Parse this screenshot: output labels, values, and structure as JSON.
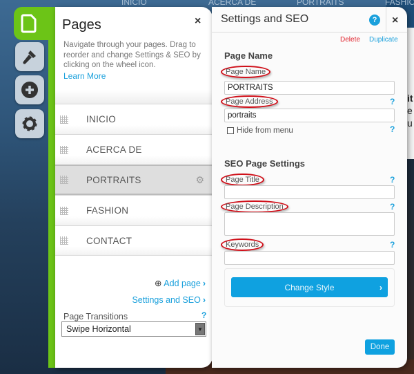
{
  "background": {
    "nav": [
      "INICIO",
      "ACERCA DE",
      "PORTRAITS",
      "FASHIO"
    ],
    "fragments": [
      "it",
      "e",
      "u"
    ]
  },
  "toolbar": {
    "items": [
      {
        "icon": "page-icon",
        "active": true
      },
      {
        "icon": "paintbrush-icon"
      },
      {
        "icon": "add-icon"
      },
      {
        "icon": "gear-icon"
      }
    ],
    "accent": "#6cc417"
  },
  "pages_panel": {
    "title": "Pages",
    "close": "×",
    "description": "Navigate through your pages. Drag to reorder and change Settings & SEO by clicking on the wheel icon.",
    "learn_more": "Learn More",
    "pages": [
      {
        "label": "INICIO"
      },
      {
        "label": "ACERCA DE"
      },
      {
        "label": "PORTRAITS",
        "selected": true
      },
      {
        "label": "FASHION"
      },
      {
        "label": "CONTACT"
      }
    ],
    "add_page": "Add page",
    "settings_seo": "Settings and SEO",
    "transitions_label": "Page Transitions",
    "help": "?",
    "transition_value": "Swipe Horizontal"
  },
  "settings_panel": {
    "title": "Settings and SEO",
    "help": "?",
    "close": "×",
    "delete": "Delete",
    "duplicate": "Duplicate",
    "page_name_heading": "Page Name",
    "page_name_label": "Page Name",
    "page_name_value": "PORTRAITS",
    "page_address_label": "Page Address",
    "page_address_value": "portraits",
    "hide_from_menu": "Hide from menu",
    "hide_from_menu_checked": false,
    "seo_heading": "SEO Page Settings",
    "page_title_label": "Page Title",
    "page_title_value": "",
    "page_description_label": "Page Description",
    "page_description_value": "",
    "keywords_label": "Keywords",
    "keywords_value": "",
    "change_style": "Change Style",
    "done": "Done",
    "primary_color": "#0fa1e0",
    "delete_color": "#e0202a"
  }
}
